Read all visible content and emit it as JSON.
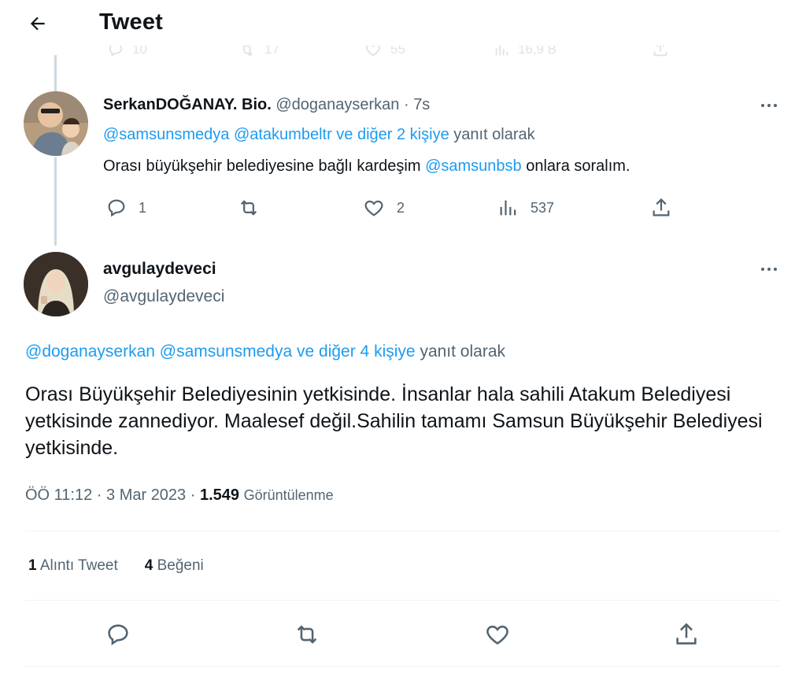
{
  "header": {
    "title": "Tweet"
  },
  "ghost_row": {
    "reply": "10",
    "retweet": "17",
    "like": "55",
    "views": "16,9 B"
  },
  "tweet1": {
    "display_name": "SerkanDOĞANAY. Bio.",
    "handle_time": "@doganayserkan · 7s",
    "reply_to": {
      "user1": "@samsunsmedya",
      "user2": "@atakumbeltr",
      "others": "ve diğer 2 kişiye",
      "suffix": "yanıt olarak"
    },
    "text_before": "Orası büyükşehir belediyesine bağlı kardeşim ",
    "text_mention": "@samsunbsb",
    "text_after": " onlara soralım.",
    "counts": {
      "replies": "1",
      "likes": "2",
      "views": "537"
    }
  },
  "tweet2": {
    "display_name": "avgulaydeveci",
    "handle": "@avgulaydeveci",
    "reply_to": {
      "user1": "@doganayserkan",
      "user2": "@samsunsmedya",
      "others": "ve diğer 4 kişiye",
      "suffix": "yanıt olarak"
    },
    "text": "Orası Büyükşehir Belediyesinin yetkisinde. İnsanlar hala sahili Atakum Belediyesi yetkisinde zannediyor. Maalesef değil.Sahilin tamamı Samsun Büyükşehir Belediyesi yetkisinde.",
    "time": "ÖÖ 11:12 · 3 Mar 2023 · ",
    "views_count": "1.549",
    "views_label": "Görüntülenme",
    "quote_count": "1",
    "quote_label": "Alıntı Tweet",
    "like_count": "4",
    "like_label": "Beğeni"
  },
  "icons": {
    "back": "arrow-left-icon",
    "more": "more-dots-icon",
    "reply": "reply-bubble-icon",
    "retweet": "retweet-icon",
    "like": "heart-icon",
    "views": "views-bars-icon",
    "share": "share-icon"
  },
  "colors": {
    "link": "#1d9bf0",
    "muted": "#536471",
    "text": "#0f1419",
    "line": "#cfd9de"
  }
}
